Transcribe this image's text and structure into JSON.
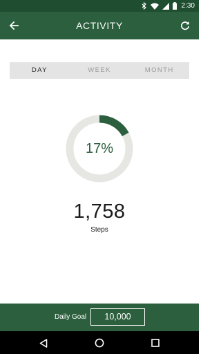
{
  "status_bar": {
    "time": "2:30",
    "icons": [
      "bluetooth-icon",
      "wifi-icon",
      "signal-icon",
      "battery-icon"
    ]
  },
  "app_bar": {
    "title": "ACTIVITY",
    "back_icon": "arrow-back-icon",
    "refresh_icon": "refresh-icon"
  },
  "tabs": [
    {
      "label": "DAY",
      "active": true
    },
    {
      "label": "WEEK",
      "active": false
    },
    {
      "label": "MONTH",
      "active": false
    }
  ],
  "progress": {
    "percent_label": "17%",
    "fraction": 0.17
  },
  "steps": {
    "value": "1,758",
    "label": "Steps"
  },
  "goal": {
    "label": "Daily Goal",
    "value": "10,000"
  },
  "nav_bar": {
    "icons": [
      "back-triangle-icon",
      "home-circle-icon",
      "recents-square-icon"
    ]
  },
  "colors": {
    "primary": "#2c5f3d",
    "status_bar": "#1f4d30",
    "ring_track": "#e6e6e2",
    "tab_background": "#e4e4e4"
  }
}
